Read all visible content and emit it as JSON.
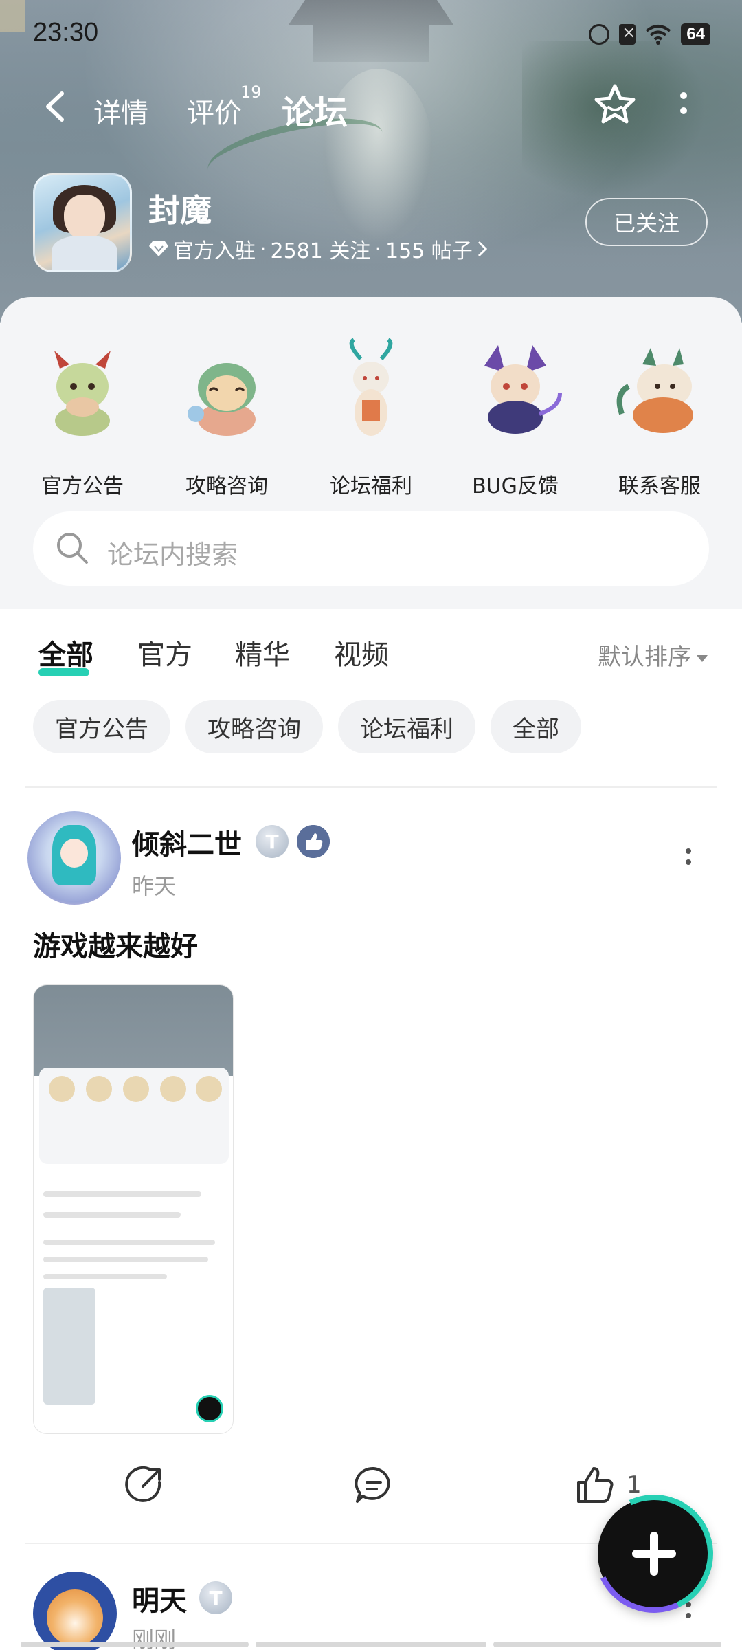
{
  "status_bar": {
    "time": "23:30",
    "battery": "64"
  },
  "nav": {
    "tabs": [
      "详情",
      "评价",
      "论坛"
    ],
    "review_count": "19",
    "active_tab": "论坛"
  },
  "game": {
    "name": "封魔",
    "official": "官方入驻",
    "followers": "2581 关注",
    "posts": "155 帖子",
    "sep": "·",
    "follow_label": "已关注"
  },
  "categories": [
    {
      "label": "官方公告",
      "icon": "green-dragon-icon"
    },
    {
      "label": "攻略咨询",
      "icon": "green-lion-icon"
    },
    {
      "label": "论坛福利",
      "icon": "white-dragon-icon"
    },
    {
      "label": "BUG反馈",
      "icon": "purple-beast-icon"
    },
    {
      "label": "联系客服",
      "icon": "qilin-icon"
    }
  ],
  "search": {
    "placeholder": "论坛内搜索"
  },
  "filter_tabs": [
    "全部",
    "官方",
    "精华",
    "视频"
  ],
  "sort_label": "默认排序",
  "chips": [
    "官方公告",
    "攻略咨询",
    "论坛福利",
    "全部"
  ],
  "posts": [
    {
      "username": "倾斜二世",
      "badge": "T",
      "time": "昨天",
      "title": "游戏越来越好",
      "likes": "1"
    },
    {
      "username": "明天",
      "badge": "T",
      "time": "刚刚"
    }
  ],
  "colors": {
    "accent": "#27d0b4",
    "fab_ring": "#7b5cf0"
  }
}
